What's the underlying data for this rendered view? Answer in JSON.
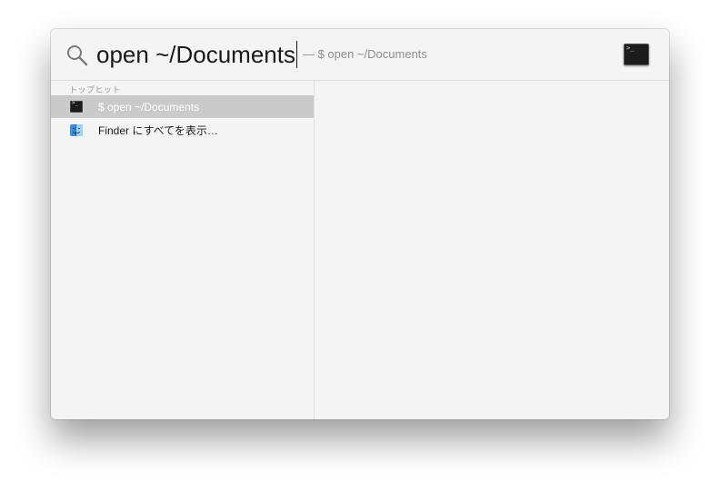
{
  "search": {
    "query": "open ~/Documents",
    "completion": "— $ open ~/Documents"
  },
  "results": {
    "section_header": "トップヒット",
    "items": [
      {
        "label": "$ open ~/Documents",
        "icon": "terminal-icon",
        "selected": true
      },
      {
        "label": "Finder にすべてを表示…",
        "icon": "finder-icon",
        "selected": false
      }
    ]
  },
  "colors": {
    "selection": "#cacaca",
    "background": "#f4f4f4"
  }
}
